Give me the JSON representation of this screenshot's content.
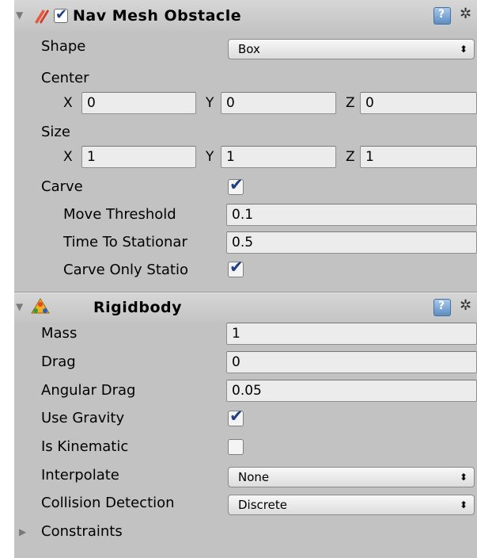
{
  "nav_mesh_obstacle": {
    "title": "Nav Mesh Obstacle",
    "enabled": true,
    "shape_label": "Shape",
    "shape_value": "Box",
    "center_label": "Center",
    "center": {
      "x_label": "X",
      "x": "0",
      "y_label": "Y",
      "y": "0",
      "z_label": "Z",
      "z": "0"
    },
    "size_label": "Size",
    "size": {
      "x_label": "X",
      "x": "1",
      "y_label": "Y",
      "y": "1",
      "z_label": "Z",
      "z": "1"
    },
    "carve_label": "Carve",
    "carve": true,
    "move_threshold_label": "Move Threshold",
    "move_threshold": "0.1",
    "time_to_stationary_label": "Time To Stationar",
    "time_to_stationary": "0.5",
    "carve_only_stationary_label": "Carve Only Statio",
    "carve_only_stationary": true
  },
  "rigidbody": {
    "title": "Rigidbody",
    "mass_label": "Mass",
    "mass": "1",
    "drag_label": "Drag",
    "drag": "0",
    "angular_drag_label": "Angular Drag",
    "angular_drag": "0.05",
    "use_gravity_label": "Use Gravity",
    "use_gravity": true,
    "is_kinematic_label": "Is Kinematic",
    "is_kinematic": false,
    "interpolate_label": "Interpolate",
    "interpolate": "None",
    "collision_detection_label": "Collision Detection",
    "collision_detection": "Discrete",
    "constraints_label": "Constraints"
  },
  "icons": {
    "help": "help-book-icon",
    "settings": "gear-icon",
    "foldout_open": "▼",
    "foldout_closed": "▶",
    "check": "✔",
    "popup_arrow": "⬍"
  }
}
